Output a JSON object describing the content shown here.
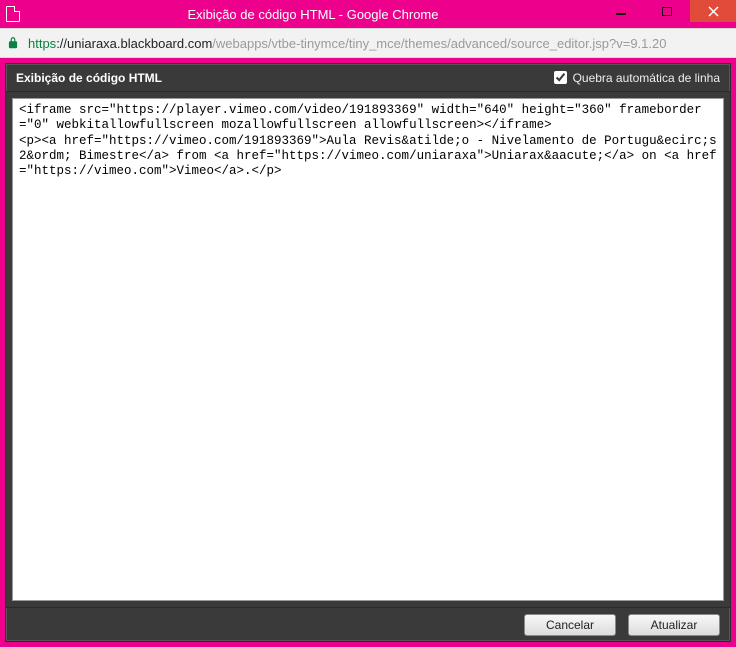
{
  "window": {
    "title": "Exibição de código HTML - Google Chrome"
  },
  "address": {
    "scheme": "https",
    "prefix": "://",
    "host": "uniaraxa.blackboard.com",
    "path": "/webapps/vtbe-tinymce/tiny_mce/themes/advanced/source_editor.jsp?v=9.1.20"
  },
  "editor": {
    "header_title": "Exibição de código HTML",
    "wrap_label": "Quebra automática de linha",
    "wrap_checked": true,
    "source_code": "<iframe src=\"https://player.vimeo.com/video/191893369\" width=\"640\" height=\"360\" frameborder=\"0\" webkitallowfullscreen mozallowfullscreen allowfullscreen></iframe>\n<p><a href=\"https://vimeo.com/191893369\">Aula Revis&atilde;o - Nivelamento de Portugu&ecirc;s 2&ordm; Bimestre</a> from <a href=\"https://vimeo.com/uniaraxa\">Uniarax&aacute;</a> on <a href=\"https://vimeo.com\">Vimeo</a>.</p>",
    "buttons": {
      "cancel": "Cancelar",
      "update": "Atualizar"
    }
  }
}
